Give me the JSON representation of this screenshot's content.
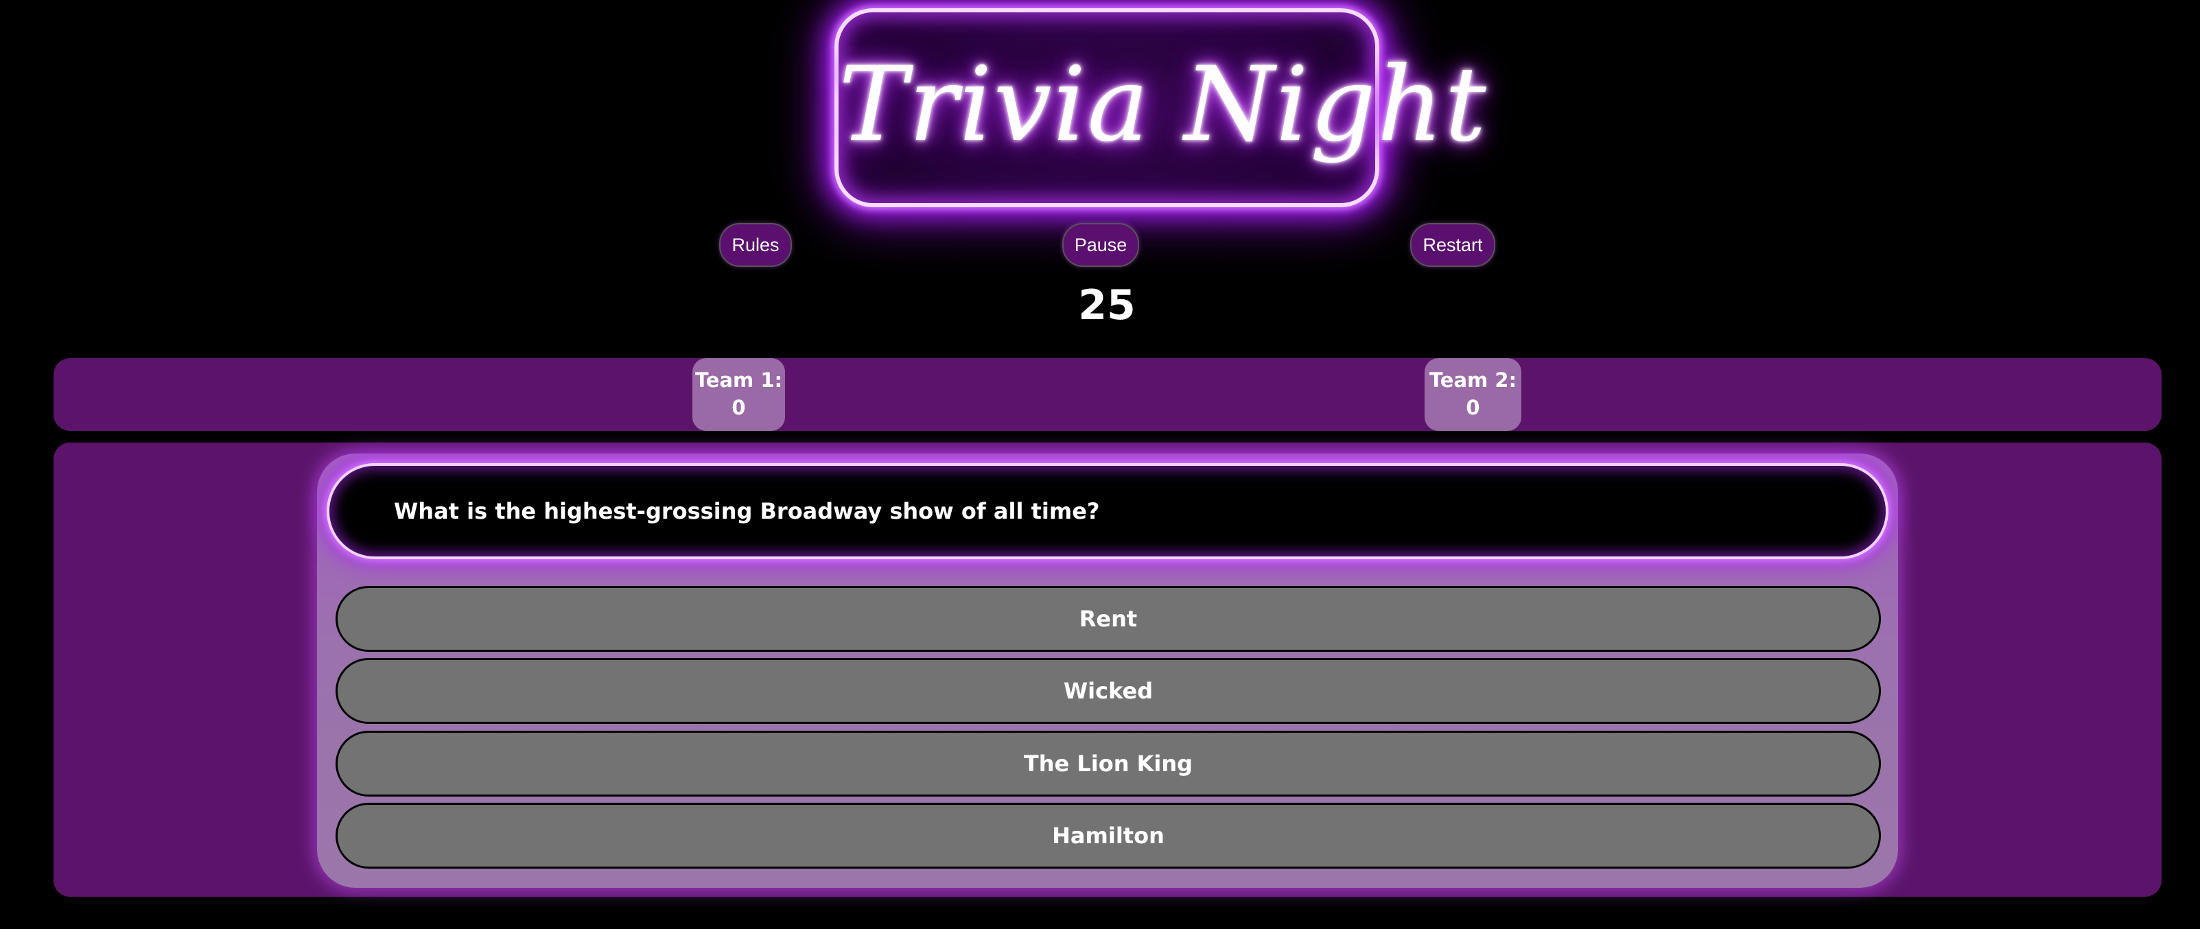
{
  "header": {
    "title": "Trivia Night"
  },
  "controls": {
    "rules_label": "Rules",
    "pause_label": "Pause",
    "restart_label": "Restart"
  },
  "timer": {
    "value": "25"
  },
  "scoreboard": {
    "teams": [
      {
        "label": "Team 1:",
        "score": "0"
      },
      {
        "label": "Team 2:",
        "score": "0"
      }
    ]
  },
  "question": {
    "text": "What is the highest-grossing Broadway show of all time?",
    "answers": [
      "Rent",
      "Wicked",
      "The Lion King",
      "Hamilton"
    ]
  },
  "colors": {
    "background": "#000000",
    "panel": "#5c146a",
    "team_card": "#9a6aa6",
    "answer_button": "#737373",
    "neon_glow": "#c040ff",
    "control_button": "#5b0f6e"
  }
}
